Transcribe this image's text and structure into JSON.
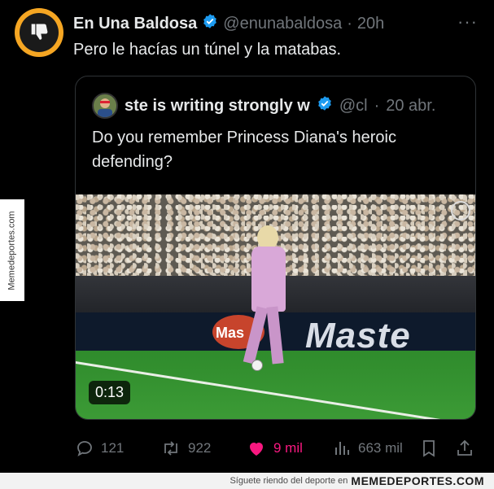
{
  "watermark": {
    "side": "Memedeportes.com"
  },
  "tweet": {
    "name": "En Una Baldosa",
    "handle": "@enunabaldosa",
    "separator": "·",
    "time": "20h",
    "more_label": "···",
    "text": "Pero le hacías un túnel y la matabas.",
    "avatar_icon": "thumbs-down-icon"
  },
  "quote": {
    "name": "ste is writing strongly w",
    "handle": "@cl",
    "separator": "·",
    "time": "20 abr.",
    "text": "Do you remember Princess Diana's heroic defending?",
    "media": {
      "banner_text": "Maste",
      "banner_red_text": "Mas",
      "duration": "0:13"
    }
  },
  "actions": {
    "replies": "121",
    "reposts": "922",
    "likes": "9 mil",
    "views": "663 mil"
  },
  "footer": {
    "text": "Síguete riendo del deporte en",
    "brand": "MEMEDEPORTES.COM"
  },
  "colors": {
    "background": "#000000",
    "text": "#e7e9ea",
    "muted": "#71767b",
    "verified": "#1d9bf0",
    "like": "#f91880",
    "avatar_ring": "#f5a623"
  }
}
